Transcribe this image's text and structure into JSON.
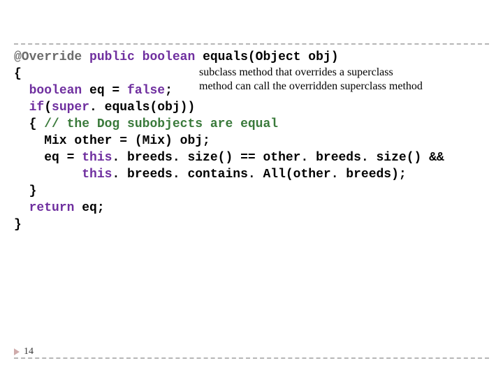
{
  "code": {
    "l1": {
      "a": "@Override ",
      "b": "public boolean ",
      "c": "equals(Object obj)"
    },
    "l2": "{",
    "l3": {
      "a": "  ",
      "b": "boolean ",
      "c": "eq = ",
      "d": "false",
      "e": ";"
    },
    "l4": {
      "a": "  ",
      "b": "if",
      "c": "(",
      "d": "super",
      "e": ". equals(obj))"
    },
    "l5": {
      "a": "  { ",
      "b": "// the Dog subobjects are equal"
    },
    "l6": {
      "a": "    Mix other = (Mix) obj;"
    },
    "l7": {
      "a": "    eq = ",
      "b": "this",
      "c": ". breeds. size() == other. breeds. size() &&"
    },
    "l8": {
      "a": "         ",
      "b": "this",
      "c": ". breeds. contains. All(other. breeds);"
    },
    "l9": "  }",
    "l10": {
      "a": "  ",
      "b": "return ",
      "c": "eq;"
    },
    "l11": "}"
  },
  "callout": {
    "line1": "subclass method that overrides a superclass",
    "line2": "method can call the overridden superclass method"
  },
  "page_number": "14"
}
